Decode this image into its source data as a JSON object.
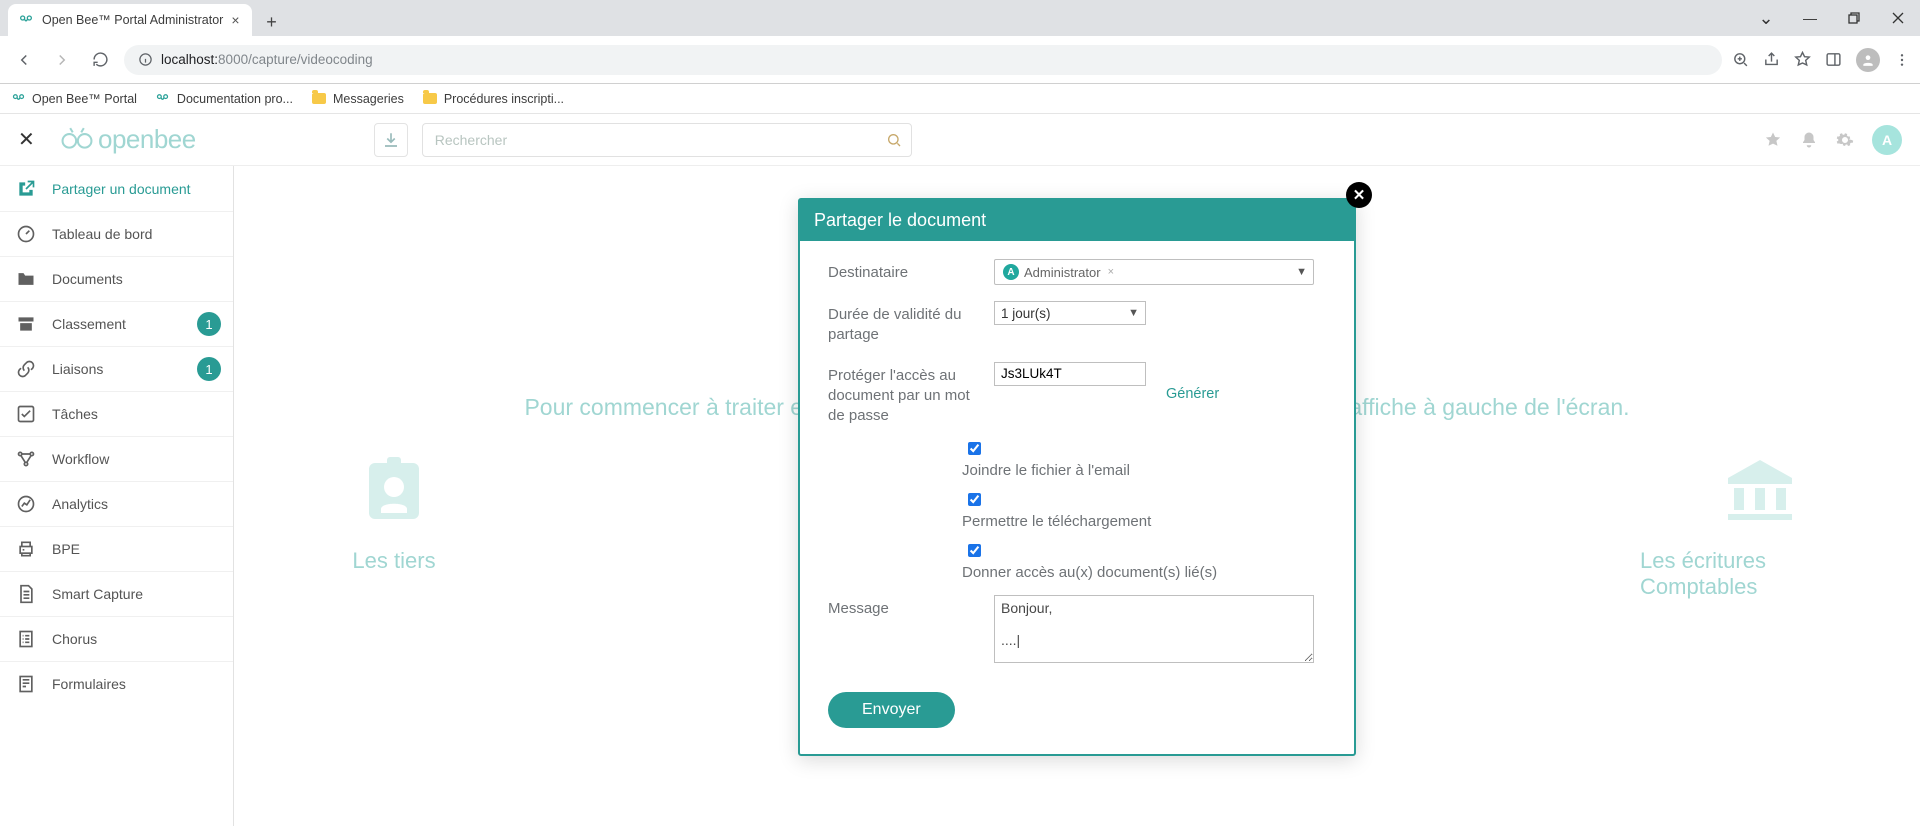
{
  "browser": {
    "tab_title": "Open Bee™ Portal Administrator",
    "url_host": "localhost:",
    "url_port_path": "8000/capture/videocoding",
    "bookmarks": [
      {
        "label": "Open Bee™ Portal",
        "icon": "bee"
      },
      {
        "label": "Documentation pro...",
        "icon": "bee"
      },
      {
        "label": "Messageries",
        "icon": "folder"
      },
      {
        "label": "Procédures inscripti...",
        "icon": "folder"
      }
    ]
  },
  "topbar": {
    "search_placeholder": "Rechercher",
    "avatar_letter": "A"
  },
  "sidebar": {
    "items": [
      {
        "label": "Partager un document",
        "icon": "share",
        "active": true
      },
      {
        "label": "Tableau de bord",
        "icon": "gauge"
      },
      {
        "label": "Documents",
        "icon": "folder"
      },
      {
        "label": "Classement",
        "icon": "archive",
        "badge": "1"
      },
      {
        "label": "Liaisons",
        "icon": "link",
        "badge": "1"
      },
      {
        "label": "Tâches",
        "icon": "check"
      },
      {
        "label": "Workflow",
        "icon": "flow"
      },
      {
        "label": "Analytics",
        "icon": "analytics"
      },
      {
        "label": "BPE",
        "icon": "printer"
      },
      {
        "label": "Smart Capture",
        "icon": "doc-lines"
      },
      {
        "label": "Chorus",
        "icon": "doc-list"
      },
      {
        "label": "Formulaires",
        "icon": "form"
      }
    ]
  },
  "background": {
    "hint": "Pour commencer à traiter et ................................................................................ s'affiche à gauche de l'écran.",
    "card_left": "Les tiers",
    "card_right": "Les écritures Comptables"
  },
  "modal": {
    "title": "Partager le document",
    "labels": {
      "recipient": "Destinataire",
      "duration": "Durée de validité du partage",
      "password": "Protéger l'accès au document par un mot de passe",
      "attach": "Joindre le fichier à l'email",
      "allow_dl": "Permettre le téléchargement",
      "linked": "Donner accès au(x) document(s) lié(s)",
      "message": "Message"
    },
    "recipient_chip": {
      "initial": "A",
      "name": "Administrator"
    },
    "duration_value": "1 jour(s)",
    "password_value": "Js3LUk4T",
    "generate": "Générer",
    "attach_checked": true,
    "allow_dl_checked": true,
    "linked_checked": true,
    "message_value": "Bonjour,\n\n....|",
    "send": "Envoyer"
  }
}
